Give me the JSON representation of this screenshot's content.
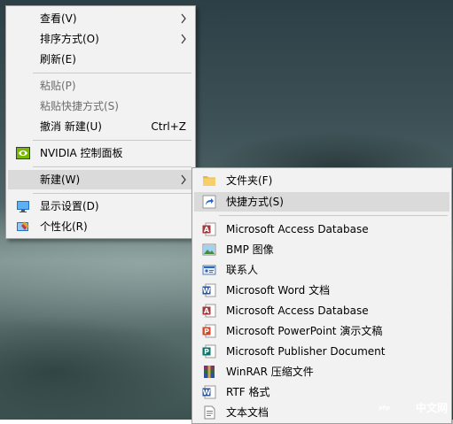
{
  "context_menu": {
    "items": [
      {
        "label": "查看(V)"
      },
      {
        "label": "排序方式(O)"
      },
      {
        "label": "刷新(E)"
      },
      {
        "label": "粘贴(P)"
      },
      {
        "label": "粘贴快捷方式(S)"
      },
      {
        "label": "撤消 新建(U)",
        "shortcut": "Ctrl+Z"
      },
      {
        "label": "NVIDIA 控制面板"
      },
      {
        "label": "新建(W)"
      },
      {
        "label": "显示设置(D)"
      },
      {
        "label": "个性化(R)"
      }
    ]
  },
  "submenu": {
    "items": [
      {
        "label": "文件夹(F)",
        "icon": "folder-icon"
      },
      {
        "label": "快捷方式(S)",
        "icon": "shortcut-icon"
      },
      {
        "label": "Microsoft Access Database",
        "icon": "access-icon"
      },
      {
        "label": "BMP 图像",
        "icon": "bmp-image-icon"
      },
      {
        "label": "联系人",
        "icon": "contact-icon"
      },
      {
        "label": "Microsoft Word 文档",
        "icon": "word-icon"
      },
      {
        "label": "Microsoft Access Database",
        "icon": "access-icon"
      },
      {
        "label": "Microsoft PowerPoint 演示文稿",
        "icon": "powerpoint-icon"
      },
      {
        "label": "Microsoft Publisher Document",
        "icon": "publisher-icon"
      },
      {
        "label": "WinRAR 压缩文件",
        "icon": "winrar-icon"
      },
      {
        "label": "RTF 格式",
        "icon": "rtf-icon"
      },
      {
        "label": "文本文档",
        "icon": "text-document-icon"
      }
    ]
  },
  "watermark": {
    "text": "中文网",
    "logo": "php"
  },
  "colors": {
    "menu_bg": "#f2f2f2",
    "highlight": "#dadada",
    "disabled_text": "#6d6d6d"
  }
}
